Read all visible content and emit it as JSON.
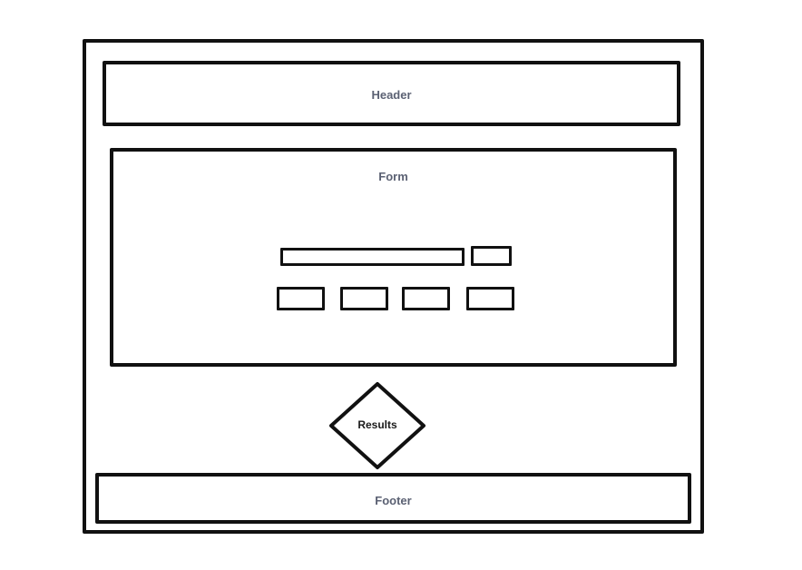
{
  "header": {
    "label": "Header"
  },
  "form": {
    "label": "Form"
  },
  "results": {
    "label": "Results"
  },
  "footer": {
    "label": "Footer"
  }
}
